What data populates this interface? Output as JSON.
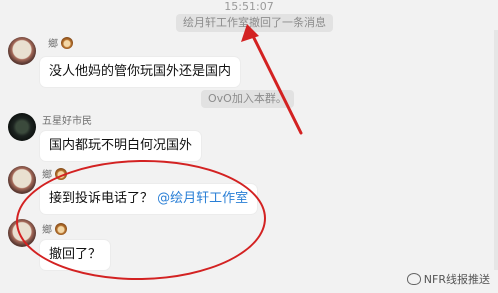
{
  "timestamp": "15:51:07",
  "system": {
    "recall_notice": "绘月轩工作室撤回了一条消息",
    "join_notice": "OvO加入本群。"
  },
  "messages": [
    {
      "sender": "鄉",
      "text": "没人他妈的管你玩国外还是国内"
    },
    {
      "sender": "五星好市民",
      "text": "国内都玩不明白何况国外"
    },
    {
      "sender": "鄉",
      "text_prefix": "接到投诉电话了？",
      "mention": "@绘月轩工作室"
    },
    {
      "sender": "鄉",
      "text": "撤回了？"
    }
  ],
  "watermark": "NFR线报推送",
  "colors": {
    "annotation": "#d32222",
    "mention": "#2a7fd6"
  }
}
